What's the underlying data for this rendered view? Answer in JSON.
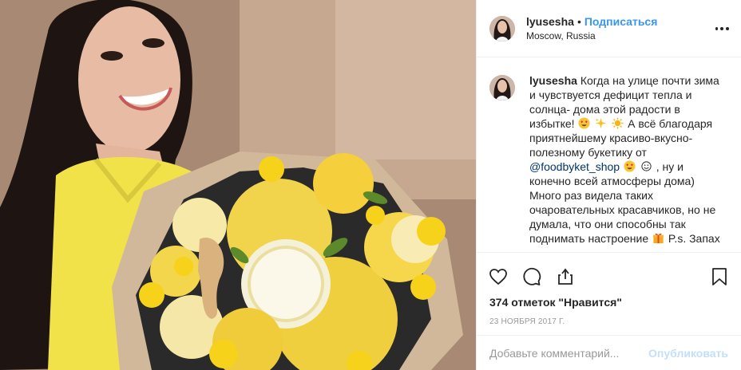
{
  "post": {
    "username": "lyusesha",
    "separator": "•",
    "follow_label": "Подписаться",
    "location": "Moscow, Russia"
  },
  "caption": {
    "author": "lyusesha",
    "part1": "Когда на улице почти зима и чувствуется дефицит тепла и солнца- дома этой радости в избытке!",
    "part2": "А всё благодаря приятнейшему красиво-вкусно-полезному букетику от",
    "mention": "@foodbyket_shop",
    "part3": ", ну и конечно всей атмосферы дома) Много раз видела таких очаровательных красавчиков, но не думала, что они способны так поднимать настроение",
    "part4": "P.s. Запах"
  },
  "icons": [
    "more-icon",
    "heart-icon",
    "comment-icon",
    "share-icon",
    "bookmark-icon",
    "heart-eyes-emoji",
    "sparkles-emoji",
    "sun-emoji",
    "gift-emoji"
  ],
  "likes_text": "374 отметок \"Нравится\"",
  "date": "23 ноября 2017 г.",
  "comment_box": {
    "placeholder": "Добавьте комментарий...",
    "publish_label": "Опубликовать"
  },
  "colors": {
    "link": "#3897f0",
    "text": "#262626",
    "muted": "#999999",
    "border": "#efefef"
  }
}
